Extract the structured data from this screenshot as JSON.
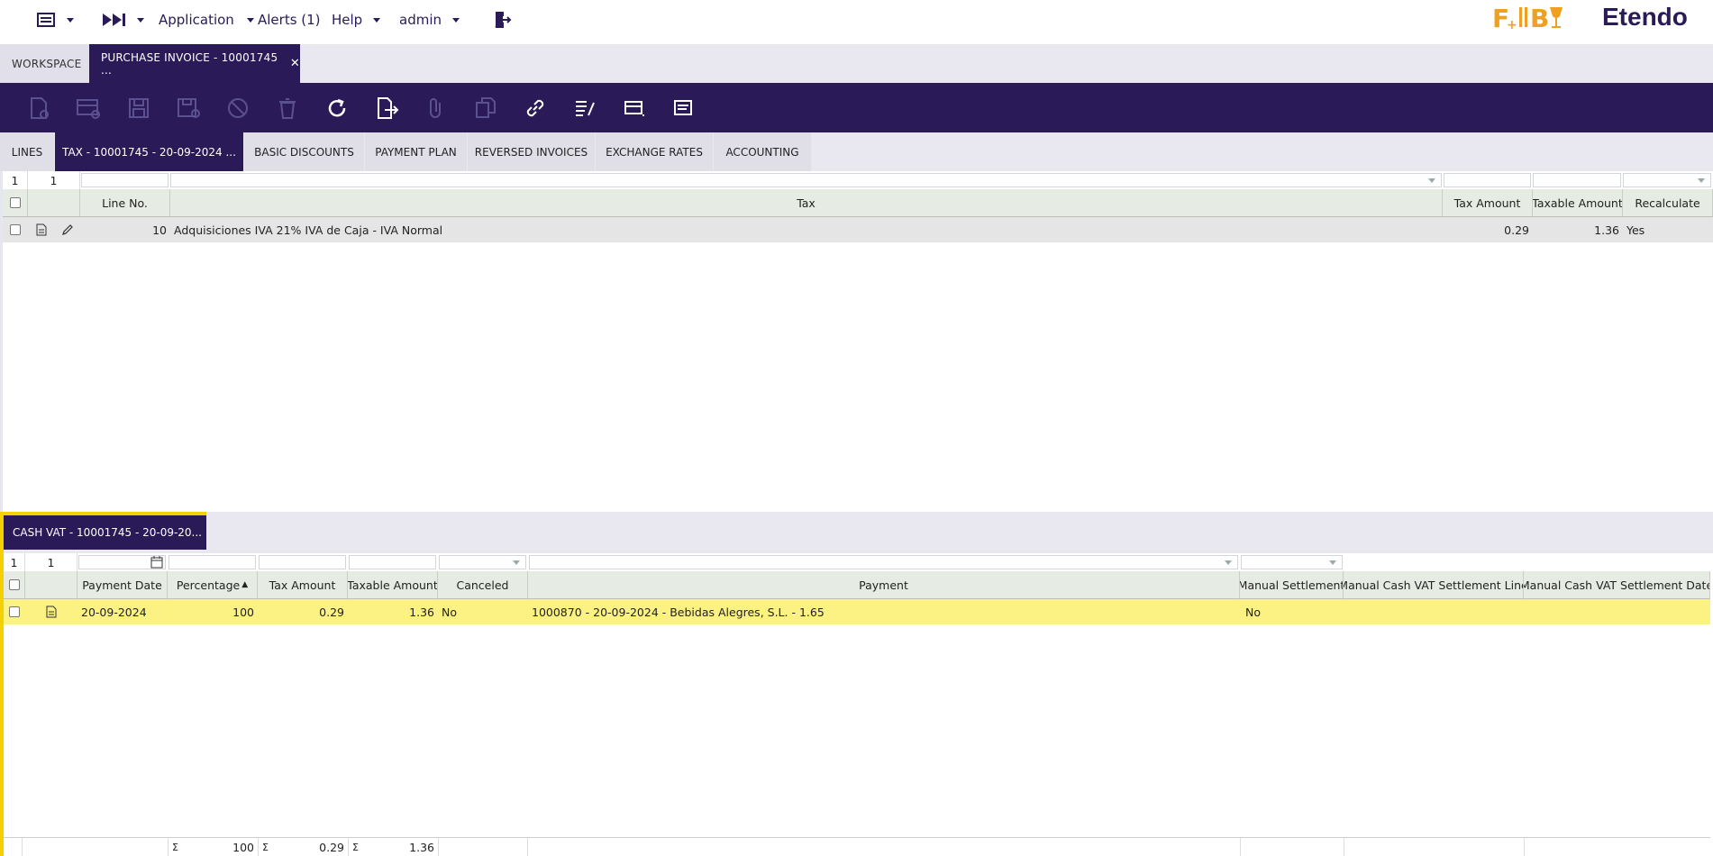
{
  "topbar": {
    "application": "Application",
    "alerts": "Alerts (1)",
    "help": "Help",
    "user": "admin",
    "brand": "Etendo"
  },
  "window_tabs": {
    "workspace": "WORKSPACE",
    "invoice": "PURCHASE INVOICE - 10001745 ..."
  },
  "sub_tabs": [
    "LINES",
    "TAX - 10001745 - 20-09-2024 ...",
    "BASIC DISCOUNTS",
    "PAYMENT PLAN",
    "REVERSED INVOICES",
    "EXCHANGE RATES",
    "ACCOUNTING"
  ],
  "tax_grid": {
    "counter": [
      "1",
      "1"
    ],
    "headers": {
      "line_no": "Line No.",
      "tax": "Tax",
      "tax_amount": "Tax Amount",
      "taxable_amount": "Taxable Amount",
      "recalculate": "Recalculate"
    },
    "rows": [
      {
        "line_no": "10",
        "tax": "Adquisiciones IVA 21% IVA de Caja - IVA Normal",
        "tax_amount": "0.29",
        "taxable_amount": "1.36",
        "recalculate": "Yes"
      }
    ]
  },
  "cash_vat": {
    "tab_label": "CASH VAT - 10001745 - 20-09-20...",
    "counter": [
      "1",
      "1"
    ],
    "headers": {
      "payment_date": "Payment Date",
      "percentage": "Percentage",
      "tax_amount": "Tax Amount",
      "taxable_amount": "Taxable Amount",
      "canceled": "Canceled",
      "payment": "Payment",
      "manual_settlement": "Manual Settlement",
      "manual_line": "Manual Cash VAT Settlement Line",
      "manual_date": "Manual Cash VAT Settlement Date"
    },
    "rows": [
      {
        "payment_date": "20-09-2024",
        "percentage": "100",
        "tax_amount": "0.29",
        "taxable_amount": "1.36",
        "canceled": "No",
        "payment": "1000870 - 20-09-2024 - Bebidas Alegres, S.L. - 1.65",
        "manual_settlement": "No",
        "manual_line": "",
        "manual_date": ""
      }
    ],
    "totals": {
      "sigma": "Σ",
      "percentage": "100",
      "tax_amount": "0.29",
      "taxable_amount": "1.36"
    }
  },
  "colors": {
    "brand": "#2a1b58",
    "selected_row": "#fbf283",
    "accent_yellow": "#f5d000",
    "logo_orange": "#f0a020"
  }
}
